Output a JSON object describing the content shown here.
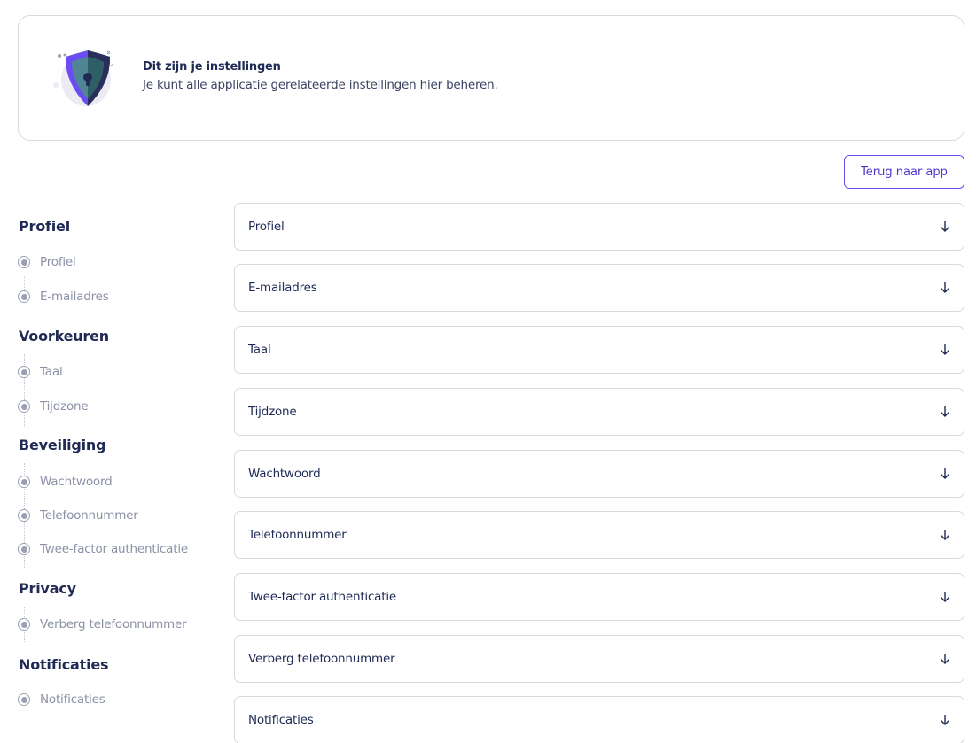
{
  "header": {
    "title": "Dit zijn je instellingen",
    "subtitle": "Je kunt alle applicatie gerelateerde instellingen hier beheren.",
    "illustration_icon": "shield-icon"
  },
  "back_button_label": "Terug naar app",
  "sidebar": {
    "groups": [
      {
        "title": "Profiel",
        "items": [
          "Profiel",
          "E-mailadres"
        ]
      },
      {
        "title": "Voorkeuren",
        "items": [
          "Taal",
          "Tijdzone"
        ]
      },
      {
        "title": "Beveiliging",
        "items": [
          "Wachtwoord",
          "Telefoonnummer",
          "Twee-factor authenticatie"
        ]
      },
      {
        "title": "Privacy",
        "items": [
          "Verberg telefoonnummer"
        ]
      },
      {
        "title": "Notificaties",
        "items": [
          "Notificaties"
        ]
      }
    ]
  },
  "sections": [
    {
      "label": "Profiel"
    },
    {
      "label": "E-mailadres"
    },
    {
      "label": "Taal"
    },
    {
      "label": "Tijdzone"
    },
    {
      "label": "Wachtwoord"
    },
    {
      "label": "Telefoonnummer"
    },
    {
      "label": "Twee-factor authenticatie"
    },
    {
      "label": "Verberg telefoonnummer"
    },
    {
      "label": "Notificaties"
    }
  ],
  "colors": {
    "accent": "#6b4cf0",
    "heading": "#1f2a55",
    "muted": "#8b91a6",
    "border": "#d7dae3"
  }
}
